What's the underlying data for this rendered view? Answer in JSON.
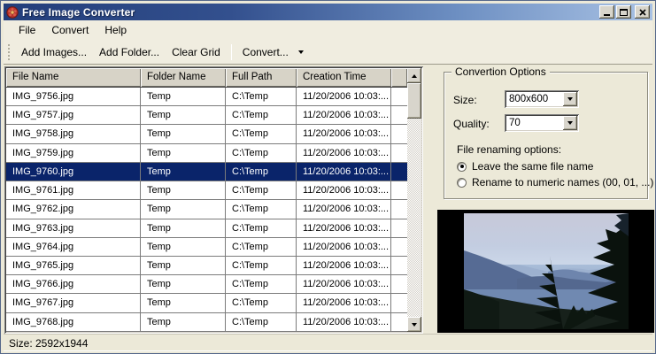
{
  "window": {
    "title": "Free Image Converter"
  },
  "menu": {
    "items": [
      "File",
      "Convert",
      "Help"
    ]
  },
  "toolbar": {
    "add_images": "Add Images...",
    "add_folder": "Add Folder...",
    "clear_grid": "Clear Grid",
    "convert": "Convert..."
  },
  "table": {
    "columns": [
      "File Name",
      "Folder Name",
      "Full Path",
      "Creation Time"
    ],
    "selected": "IMG_9760.jpg",
    "rows": [
      {
        "name": "IMG_9756.jpg",
        "folder": "Temp",
        "path": "C:\\Temp",
        "time": "11/20/2006 10:03:..."
      },
      {
        "name": "IMG_9757.jpg",
        "folder": "Temp",
        "path": "C:\\Temp",
        "time": "11/20/2006 10:03:..."
      },
      {
        "name": "IMG_9758.jpg",
        "folder": "Temp",
        "path": "C:\\Temp",
        "time": "11/20/2006 10:03:..."
      },
      {
        "name": "IMG_9759.jpg",
        "folder": "Temp",
        "path": "C:\\Temp",
        "time": "11/20/2006 10:03:..."
      },
      {
        "name": "IMG_9760.jpg",
        "folder": "Temp",
        "path": "C:\\Temp",
        "time": "11/20/2006 10:03:..."
      },
      {
        "name": "IMG_9761.jpg",
        "folder": "Temp",
        "path": "C:\\Temp",
        "time": "11/20/2006 10:03:..."
      },
      {
        "name": "IMG_9762.jpg",
        "folder": "Temp",
        "path": "C:\\Temp",
        "time": "11/20/2006 10:03:..."
      },
      {
        "name": "IMG_9763.jpg",
        "folder": "Temp",
        "path": "C:\\Temp",
        "time": "11/20/2006 10:03:..."
      },
      {
        "name": "IMG_9764.jpg",
        "folder": "Temp",
        "path": "C:\\Temp",
        "time": "11/20/2006 10:03:..."
      },
      {
        "name": "IMG_9765.jpg",
        "folder": "Temp",
        "path": "C:\\Temp",
        "time": "11/20/2006 10:03:..."
      },
      {
        "name": "IMG_9766.jpg",
        "folder": "Temp",
        "path": "C:\\Temp",
        "time": "11/20/2006 10:03:..."
      },
      {
        "name": "IMG_9767.jpg",
        "folder": "Temp",
        "path": "C:\\Temp",
        "time": "11/20/2006 10:03:..."
      },
      {
        "name": "IMG_9768.jpg",
        "folder": "Temp",
        "path": "C:\\Temp",
        "time": "11/20/2006 10:03:..."
      }
    ]
  },
  "options": {
    "title": "Convertion Options",
    "size_label": "Size:",
    "size_value": "800x600",
    "quality_label": "Quality:",
    "quality_value": "70",
    "rename_label": "File renaming options:",
    "radios": [
      {
        "label": "Leave the same file name",
        "selected": true
      },
      {
        "label": "Rename to numeric names (00, 01, ...)",
        "selected": false
      }
    ]
  },
  "status": {
    "text": "Size: 2592x1944"
  },
  "colors": {
    "selection": "#0a246a",
    "titlebar_left": "#233e7a",
    "titlebar_right": "#a9c2e4",
    "panel_bg": "#ece9d8"
  }
}
